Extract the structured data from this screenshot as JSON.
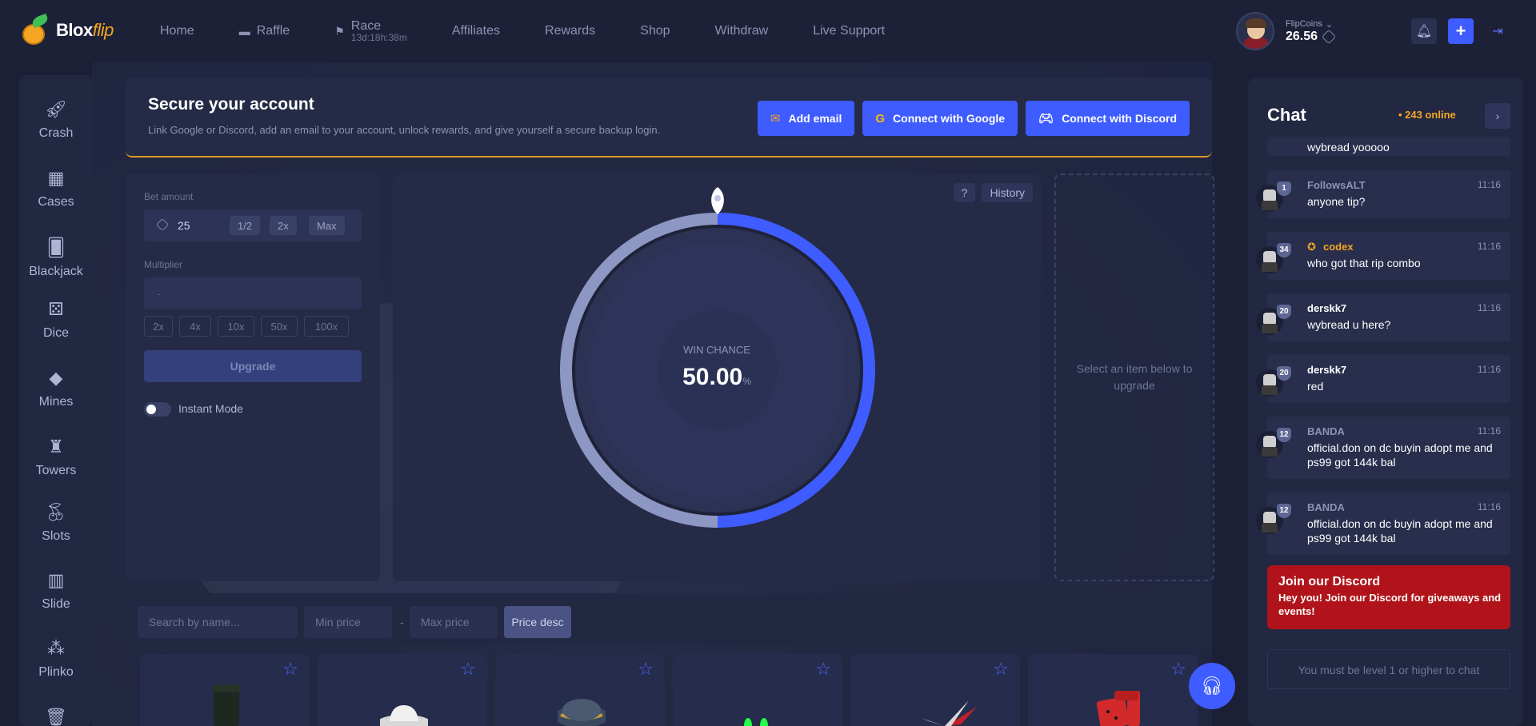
{
  "brand": {
    "name": "Blox",
    "accent": "flip"
  },
  "nav": {
    "home": "Home",
    "raffle": "Raffle",
    "race": "Race",
    "race_timer": "13d:18h:38m",
    "affiliates": "Affiliates",
    "rewards": "Rewards",
    "shop": "Shop",
    "withdraw": "Withdraw",
    "live_support": "Live Support"
  },
  "user": {
    "balance_label": "FlipCoins",
    "balance": "26.56"
  },
  "sidebar": {
    "items": [
      {
        "label": "Crash",
        "icon": "rocket-icon"
      },
      {
        "label": "Cases",
        "icon": "cases-icon"
      },
      {
        "label": "Blackjack",
        "icon": "cards-icon"
      },
      {
        "label": "Dice",
        "icon": "dice-icon"
      },
      {
        "label": "Mines",
        "icon": "gem-icon"
      },
      {
        "label": "Towers",
        "icon": "tower-icon"
      },
      {
        "label": "Slots",
        "icon": "cherry-icon"
      },
      {
        "label": "Slide",
        "icon": "slide-icon"
      },
      {
        "label": "Plinko",
        "icon": "plinko-icon"
      }
    ]
  },
  "secure": {
    "title": "Secure your account",
    "desc": "Link Google or Discord, add an email to your account, unlock rewards, and give yourself a secure backup login.",
    "add_email": "Add email",
    "google": "Connect with Google",
    "discord": "Connect with Discord"
  },
  "bet": {
    "amount_label": "Bet amount",
    "amount": "25",
    "half": "1/2",
    "double": "2x",
    "max": "Max",
    "multiplier_label": "Multiplier",
    "multiplier_placeholder": "-",
    "multipliers": [
      "2x",
      "4x",
      "10x",
      "50x",
      "100x"
    ],
    "upgrade": "Upgrade",
    "instant_mode": "Instant Mode"
  },
  "wheel": {
    "help": "?",
    "history": "History",
    "win_label": "WIN CHANCE",
    "win_value": "50.00",
    "win_unit": "%",
    "win_fraction": 0.5
  },
  "select_item": "Select an item below to upgrade",
  "filters": {
    "search_placeholder": "Search by name...",
    "min_price": "Min price",
    "dash": "-",
    "max_price": "Max price",
    "sort": "Price desc"
  },
  "chat": {
    "title": "Chat",
    "online": "• 243 online",
    "messages": [
      {
        "name": "",
        "time": "",
        "text": "wybread yooooo",
        "level": ""
      },
      {
        "name": "FollowsALT",
        "time": "11:16",
        "text": "anyone tip?",
        "level": "1"
      },
      {
        "name": "codex",
        "time": "11:16",
        "text": "who got that rip combo",
        "level": "34"
      },
      {
        "name": "derskk7",
        "time": "11:16",
        "text": "wybread u here?",
        "level": "20"
      },
      {
        "name": "derskk7",
        "time": "11:16",
        "text": "red",
        "level": "20"
      },
      {
        "name": "BANDA",
        "time": "11:16",
        "text": "official.don on dc buyin adopt me and ps99 got 144k bal",
        "level": "12"
      },
      {
        "name": "BANDA",
        "time": "11:16",
        "text": "official.don on dc buyin adopt me and ps99 got 144k bal",
        "level": "12"
      }
    ],
    "discord_title": "Join our Discord",
    "discord_text": "Hey you! Join our Discord for giveaways and events!",
    "input_placeholder": "You must be level 1 or higher to chat"
  },
  "colors": {
    "accent": "#3e5cff",
    "gold": "#f5a623",
    "wheel_light": "#8d97c4",
    "wheel_blue": "#3e5cff"
  }
}
